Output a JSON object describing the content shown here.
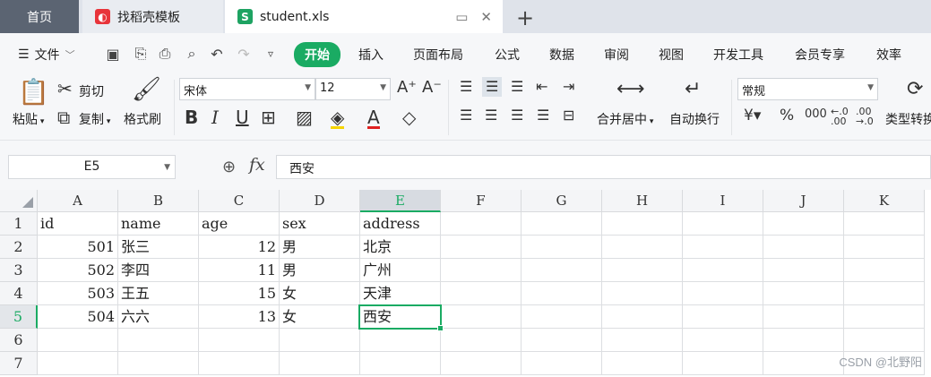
{
  "tabs": {
    "home": "首页",
    "template": "找稻壳模板",
    "file": "student.xls",
    "template_icon": "daoke-logo-icon",
    "file_icon": "spreadsheet-s-icon"
  },
  "menu": {
    "file_label": "文件",
    "tabs": [
      "开始",
      "插入",
      "页面布局",
      "公式",
      "数据",
      "审阅",
      "视图",
      "开发工具",
      "会员专享",
      "效率"
    ],
    "active_tab": "开始",
    "accent": "#1aab63"
  },
  "ribbon": {
    "paste": "粘贴",
    "cut": "剪切",
    "copy": "复制",
    "format_painter": "格式刷",
    "font_name": "宋体",
    "font_size": "12",
    "merge_center": "合并居中",
    "wrap_text": "自动换行",
    "number_format": "常规",
    "convert_type": "类型转换",
    "bold": "B",
    "italic": "I",
    "underline": "U"
  },
  "formula_bar": {
    "cell_ref": "E5",
    "fx": "fx",
    "value": "西安"
  },
  "sheet": {
    "columns": [
      "A",
      "B",
      "C",
      "D",
      "E",
      "F",
      "G",
      "H",
      "I",
      "J",
      "K"
    ],
    "rows": [
      "1",
      "2",
      "3",
      "4",
      "5",
      "6",
      "7"
    ],
    "selected_column": "E",
    "selected_row": "5",
    "cells": [
      [
        "id",
        "name",
        "age",
        "sex",
        "address"
      ],
      [
        "501",
        "张三",
        "12",
        "男",
        "北京"
      ],
      [
        "502",
        "李四",
        "11",
        "男",
        "广州"
      ],
      [
        "503",
        "王五",
        "15",
        "女",
        "天津"
      ],
      [
        "504",
        "六六",
        "13",
        "女",
        "西安"
      ]
    ]
  },
  "watermark": "CSDN @北野阳"
}
